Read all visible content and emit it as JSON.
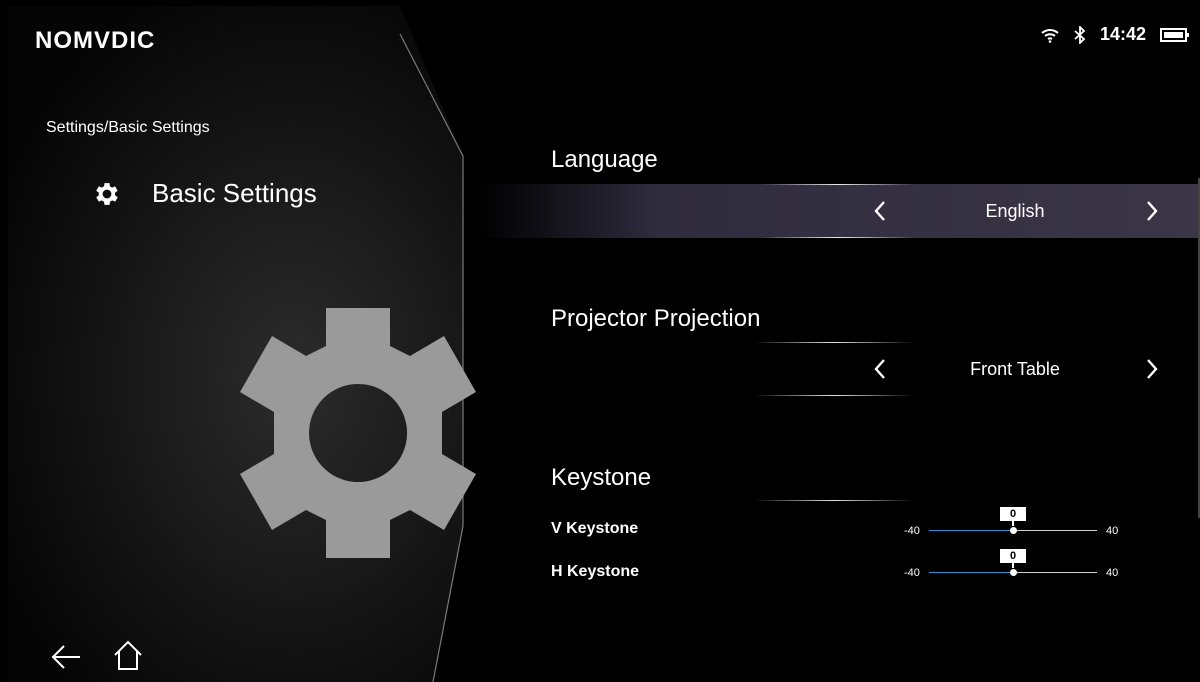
{
  "brand": {
    "logo": "NOMVDIC"
  },
  "status": {
    "time": "14:42",
    "wifi_icon": "wifi-icon",
    "bluetooth_icon": "bluetooth-icon",
    "battery_icon": "battery-icon"
  },
  "sidebar": {
    "breadcrumb": "Settings/Basic Settings",
    "section_title": "Basic Settings",
    "section_icon": "gear-icon"
  },
  "settings": {
    "language": {
      "label": "Language",
      "value": "English"
    },
    "projection": {
      "label": "Projector Projection",
      "value": "Front Table"
    },
    "keystone": {
      "label": "Keystone",
      "v": {
        "label": "V Keystone",
        "min": "-40",
        "max": "40",
        "value": "0"
      },
      "h": {
        "label": "H Keystone",
        "min": "-40",
        "max": "40",
        "value": "0"
      }
    }
  },
  "nav": {
    "back_icon": "back-arrow-icon",
    "home_icon": "home-icon"
  },
  "colors": {
    "accent": "#2b8fd6",
    "highlight_row": "#3a3648",
    "background": "#000000"
  }
}
